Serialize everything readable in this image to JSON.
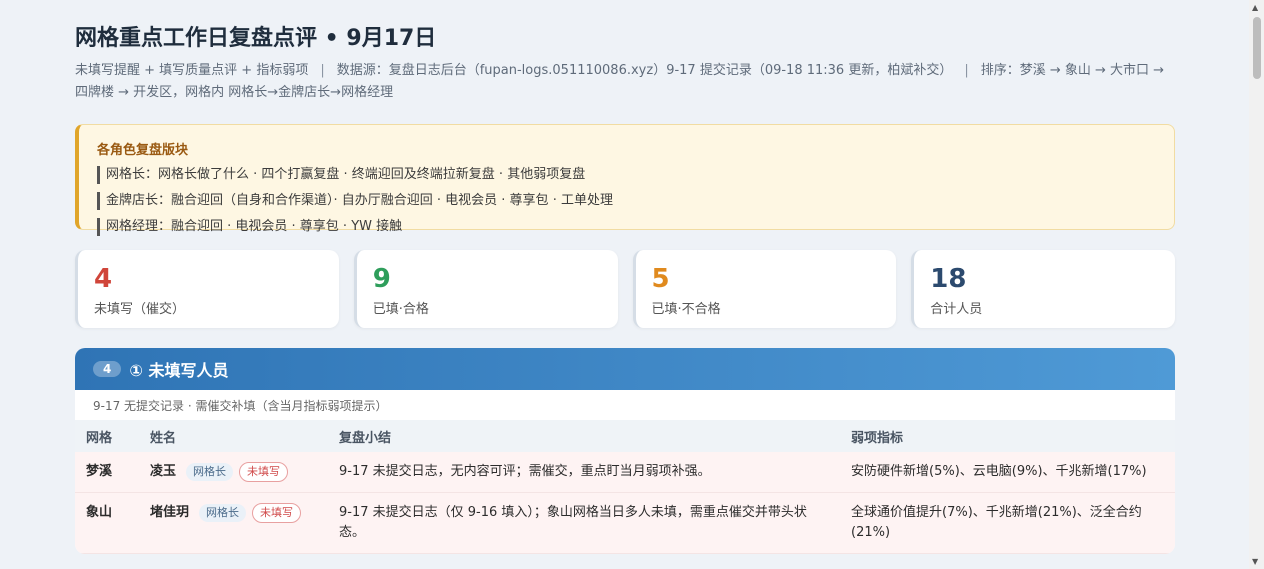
{
  "header": {
    "title": "网格重点工作日复盘点评 • 9月17日",
    "subtitle_parts": [
      "未填写提醒 + 填写质量点评 + 指标弱项",
      "数据源：复盘日志后台（fupan-logs.051110086.xyz）9-17 提交记录（09-18 11:36 更新，柏斌补交）",
      "排序：梦溪 → 象山 → 大市口 → 四牌楼 → 开发区，网格内 网格长→金牌店长→网格经理"
    ],
    "separator": "|"
  },
  "notice": {
    "title": "各角色复盘版块",
    "lines": [
      "网格长：网格长做了什么 · 四个打赢复盘 · 终端迎回及终端拉新复盘 · 其他弱项复盘",
      "金牌店长：融合迎回（自身和合作渠道）· 自办厅融合迎回 · 电视会员 · 尊享包 · 工单处理",
      "网格经理：融合迎回 · 电视会员 · 尊享包 · YW 接触"
    ]
  },
  "stats": [
    {
      "value": "4",
      "label": "未填写（催交）",
      "color": "#d0453a"
    },
    {
      "value": "9",
      "label": "已填·合格",
      "color": "#2e9e5b"
    },
    {
      "value": "5",
      "label": "已填·不合格",
      "color": "#e08a1e"
    },
    {
      "value": "18",
      "label": "合计人员",
      "color": "#2c4a6e"
    }
  ],
  "section": {
    "count": "4",
    "title": "① 未填写人员",
    "note": "9-17 无提交记录 · 需催交补填（含当月指标弱项提示）",
    "columns": [
      "网格",
      "姓名",
      "复盘小结",
      "弱项指标"
    ],
    "rows": [
      {
        "grid": "梦溪",
        "name": "凌玉",
        "role": "网格长",
        "status": "未填写",
        "summary": "9-17 未提交日志，无内容可评；需催交，重点盯当月弱项补强。",
        "weak": "安防硬件新增(5%)、云电脑(9%)、千兆新增(17%)"
      },
      {
        "grid": "象山",
        "name": "堵佳玥",
        "role": "网格长",
        "status": "未填写",
        "summary": "9-17 未提交日志（仅 9-16 填入）；象山网格当日多人未填，需重点催交并带头状态。",
        "weak": "全球通价值提升(7%)、千兆新增(21%)、泛全合约(21%)"
      }
    ]
  }
}
